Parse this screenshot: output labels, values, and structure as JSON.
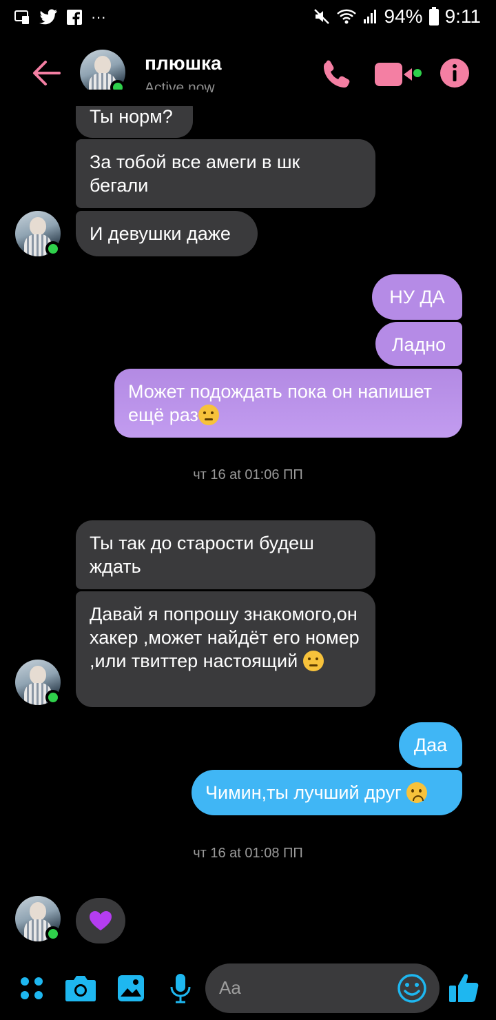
{
  "status_bar": {
    "battery": "94%",
    "time": "9:11",
    "more": "···"
  },
  "header": {
    "name": "плюшка",
    "status": "Active now"
  },
  "messages": [
    {
      "text": "Ты норм?"
    },
    {
      "text": "За тобой все амеги в шк бегали"
    },
    {
      "text": "И девушки даже"
    },
    {
      "text": "НУ ДА"
    },
    {
      "text": "Ладно"
    },
    {
      "text": "Может подождать пока он напишет ещё раз"
    },
    {
      "text": "Ты так до старости будеш ждать"
    },
    {
      "text": "Давай я попрошу знакомого,он хакер ,может найдёт его номер ,или твиттер настоящий"
    },
    {
      "text": "Даа"
    },
    {
      "text": "Чимин,ты лучший друг"
    }
  ],
  "timestamps": [
    "чт 16 at 01:06 ПП",
    "чт 16 at 01:08 ПП"
  ],
  "composer": {
    "placeholder": "Aa"
  },
  "colors": {
    "accent_pink": "#f47fa3",
    "accent_blue": "#1eb7f0",
    "bubble_incoming": "#3a3a3c",
    "bubble_purple": "#b58be6",
    "bubble_blue": "#40b6f5",
    "online": "#2fd04b"
  }
}
